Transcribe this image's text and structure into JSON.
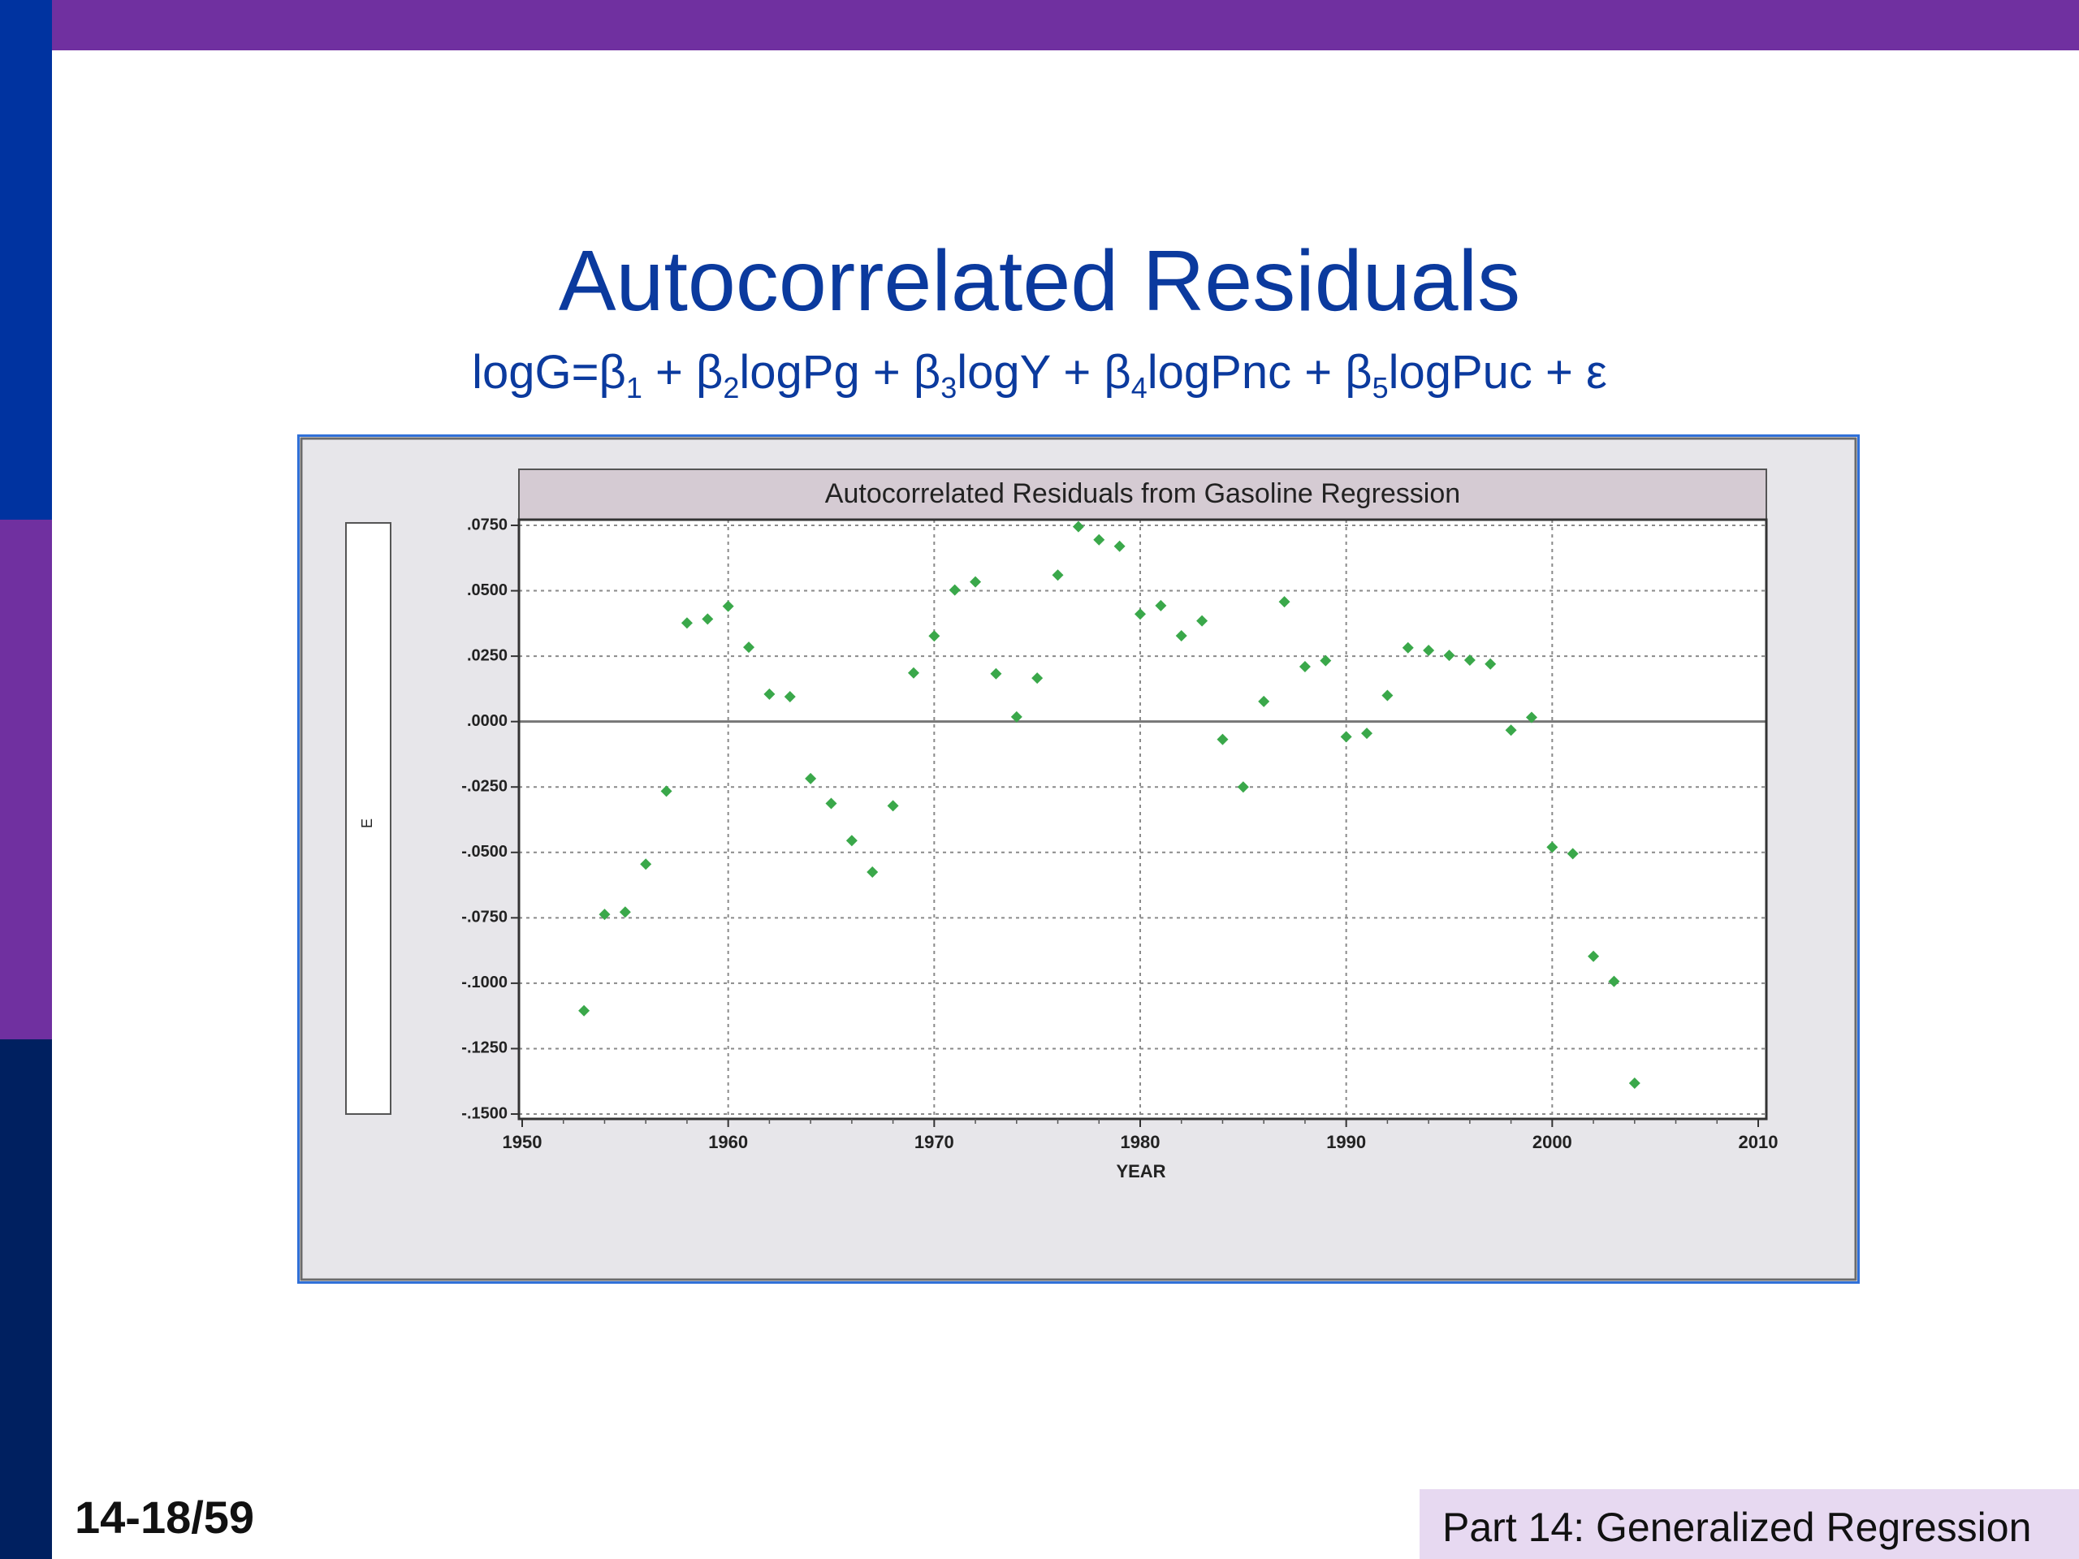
{
  "slide": {
    "title": "Autocorrelated Residuals",
    "subtitle_parts": [
      "logG=β",
      "1",
      " + β",
      "2",
      "logPg + β",
      "3",
      "logY + β",
      "4",
      "logPnc + β",
      "5",
      "logPuc + ε"
    ],
    "page_number": "14-18/59",
    "footer_text": "Part 14: Generalized Regression"
  },
  "colors": {
    "accent_purple": "#7030a0",
    "accent_blue": "#0033a0",
    "accent_navy": "#002060",
    "title_blue": "#0b3a9e",
    "point_green": "#3aa84a"
  },
  "chart_data": {
    "type": "scatter",
    "title": "Autocorrelated Residuals from Gasoline Regression",
    "xlabel": "YEAR",
    "ylabel": "E",
    "xlim": [
      1950,
      2010
    ],
    "ylim": [
      -0.15,
      0.075
    ],
    "xticks": [
      1950,
      1960,
      1970,
      1980,
      1990,
      2000,
      2010
    ],
    "xtick_labels": [
      "1950",
      "1960",
      "1970",
      "1980",
      "1990",
      "2000",
      "2010"
    ],
    "yticks": [
      0.075,
      0.05,
      0.025,
      0,
      -0.025,
      -0.05,
      -0.075,
      -0.1,
      -0.125,
      -0.15
    ],
    "ytick_labels": [
      ".0750",
      ".0500",
      ".0250",
      ".0000",
      "-.0250",
      "-.0500",
      "-.0750",
      "-.1000",
      "-.1250",
      "-.1500"
    ],
    "grid": true,
    "legend": "none",
    "x": [
      1953,
      1954,
      1955,
      1956,
      1957,
      1958,
      1959,
      1960,
      1961,
      1962,
      1963,
      1964,
      1965,
      1966,
      1967,
      1968,
      1969,
      1970,
      1971,
      1972,
      1973,
      1974,
      1975,
      1976,
      1977,
      1978,
      1979,
      1980,
      1981,
      1982,
      1983,
      1984,
      1985,
      1986,
      1987,
      1988,
      1989,
      1990,
      1991,
      1992,
      1993,
      1994,
      1995,
      1996,
      1997,
      1998,
      1999,
      2000,
      2001,
      2002,
      2003,
      2004
    ],
    "y": [
      -0.1105,
      -0.0737,
      -0.0728,
      -0.0545,
      -0.0266,
      0.0377,
      0.0392,
      0.0441,
      0.0284,
      0.0105,
      0.0095,
      -0.0218,
      -0.0313,
      -0.0455,
      -0.0575,
      -0.0322,
      0.0186,
      0.0327,
      0.0503,
      0.0534,
      0.0183,
      0.0018,
      0.0166,
      0.056,
      0.0745,
      0.0695,
      0.067,
      0.0411,
      0.0443,
      0.0328,
      0.0385,
      -0.0068,
      -0.025,
      0.0077,
      0.0458,
      0.021,
      0.0233,
      -0.0058,
      -0.0045,
      0.01,
      0.0282,
      0.0272,
      0.0253,
      0.0235,
      0.022,
      -0.0033,
      0.0016,
      -0.048,
      -0.0505,
      -0.0897,
      -0.0993,
      -0.1382
    ]
  }
}
